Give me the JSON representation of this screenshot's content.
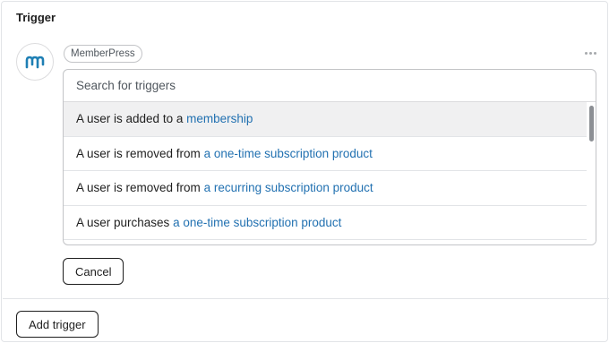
{
  "header": {
    "title": "Trigger"
  },
  "integration": {
    "logo_icon": "memberpress-logo-icon",
    "name": "MemberPress",
    "brand_color": "#1e7fb4"
  },
  "menu": {
    "icon": "more-horizontal-icon"
  },
  "search": {
    "placeholder": "Search for triggers",
    "value": ""
  },
  "triggers": [
    {
      "prefix": "A user is added to a",
      "link": "membership"
    },
    {
      "prefix": "A user is removed from",
      "link": "a one-time subscription product"
    },
    {
      "prefix": "A user is removed from",
      "link": "a recurring subscription product"
    },
    {
      "prefix": "A user purchases",
      "link": "a one-time subscription product"
    },
    {
      "prefix": "",
      "link": ""
    }
  ],
  "buttons": {
    "cancel": "Cancel",
    "add_trigger": "Add trigger"
  },
  "colors": {
    "link": "#2271b1",
    "active_row": "#f0f0f1"
  }
}
